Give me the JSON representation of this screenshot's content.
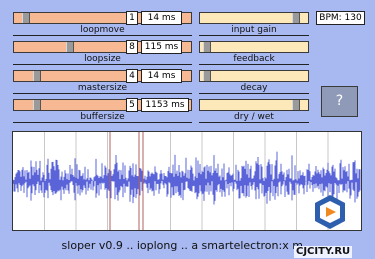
{
  "app": {
    "name": "sloper",
    "footer_text": "sloper v0.9 .. ioplong .. a smartelectron:x m...",
    "bpm_text": "BPM: 130",
    "help_label": "?",
    "watermark": "CJCITY.RU"
  },
  "left_controls": [
    {
      "label": "loopmove",
      "value": 0.05,
      "num": "1",
      "ms": "14 ms"
    },
    {
      "label": "loopsize",
      "value": 0.31,
      "num": "8",
      "ms": "115 ms"
    },
    {
      "label": "mastersize",
      "value": 0.11,
      "num": "4",
      "ms": "14 ms"
    },
    {
      "label": "buffersize",
      "value": 0.11,
      "num": "5",
      "ms": "1153 ms"
    }
  ],
  "right_controls": [
    {
      "label": "input gain",
      "value": 0.92
    },
    {
      "label": "feedback",
      "value": 0.03
    },
    {
      "label": "decay",
      "value": 0.03
    },
    {
      "label": "dry / wet",
      "value": 0.92
    }
  ],
  "colors": {
    "background": "#a8b8f0",
    "left_slider": "#f7b894",
    "right_slider": "#fce8b8",
    "wave": "#5a64d8",
    "grid": "#c8c8c8",
    "marker": "#b06060"
  }
}
